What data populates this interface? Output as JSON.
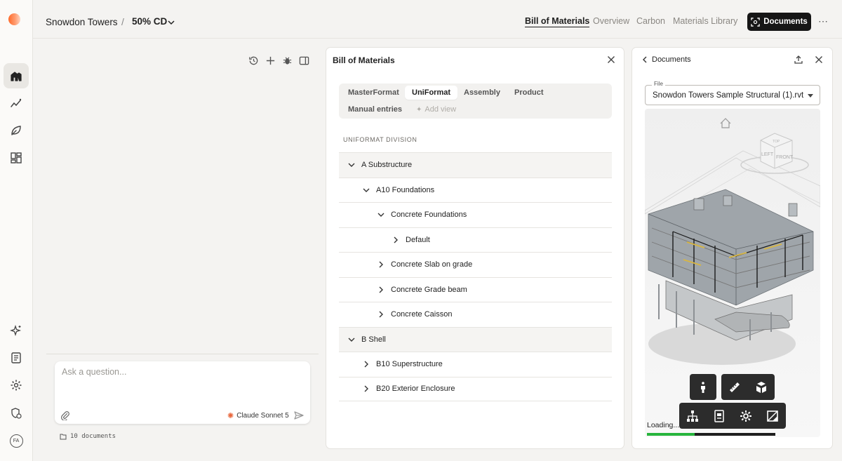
{
  "breadcrumb": {
    "project": "Snowdon Towers",
    "separator": "/",
    "phase": "50% CD"
  },
  "nav": {
    "tabs": [
      {
        "label": "Bill of Materials",
        "active": true
      },
      {
        "label": "Overview",
        "active": false
      },
      {
        "label": "Carbon",
        "active": false
      },
      {
        "label": "Materials Library",
        "active": false
      }
    ],
    "documents_button": "Documents",
    "more": "⋯"
  },
  "rail": {
    "icons": [
      "home-icon",
      "analytics-icon",
      "leaf-icon",
      "dashboard-icon",
      "sparkle-icon",
      "notes-icon",
      "settings-icon",
      "shield-icon",
      "avatar"
    ],
    "avatar_initials": "FA"
  },
  "chat": {
    "toolbar_icons": [
      "history-icon",
      "plus-icon",
      "bug-icon",
      "panel-icon"
    ],
    "placeholder": "Ask a question...",
    "model": "Claude Sonnet 5",
    "documents_count": "10 documents"
  },
  "bom": {
    "title": "Bill of Materials",
    "tabs": [
      "MasterFormat",
      "UniFormat",
      "Assembly",
      "Product",
      "Manual entries"
    ],
    "active_tab": "UniFormat",
    "add_view": "Add view",
    "column_header": "UNIFORMAT DIVISION",
    "rows": [
      {
        "label": "A Substructure",
        "level": 0,
        "expanded": true
      },
      {
        "label": "A10 Foundations",
        "level": 1,
        "expanded": true
      },
      {
        "label": "Concrete Foundations",
        "level": 2,
        "expanded": true
      },
      {
        "label": "Default",
        "level": 3,
        "expanded": false
      },
      {
        "label": "Concrete Slab on grade",
        "level": 2,
        "expanded": false
      },
      {
        "label": "Concrete Grade beam",
        "level": 2,
        "expanded": false
      },
      {
        "label": "Concrete Caisson",
        "level": 2,
        "expanded": false
      },
      {
        "label": "B Shell",
        "level": 0,
        "expanded": true
      },
      {
        "label": "B10 Superstructure",
        "level": 1,
        "expanded": false
      },
      {
        "label": "B20 Exterior Enclosure",
        "level": 1,
        "expanded": false
      }
    ]
  },
  "documents_panel": {
    "back_label": "Documents",
    "file_label": "File",
    "file_value": "Snowdon Towers Sample Structural (1).rvt",
    "viewcube": {
      "top": "TOP",
      "left": "LEFT",
      "front": "FRONT"
    },
    "loading_text": "Loading...",
    "loading_progress": 0.37,
    "toolbar_icons": [
      "person-icon",
      "ruler-icon",
      "explode-icon",
      "structure-icon",
      "properties-icon",
      "settings-icon",
      "fullscreen-icon"
    ]
  },
  "colors": {
    "accent_orange": "#e8663b",
    "progress_green": "#27b43c",
    "button_dark": "#161616"
  }
}
